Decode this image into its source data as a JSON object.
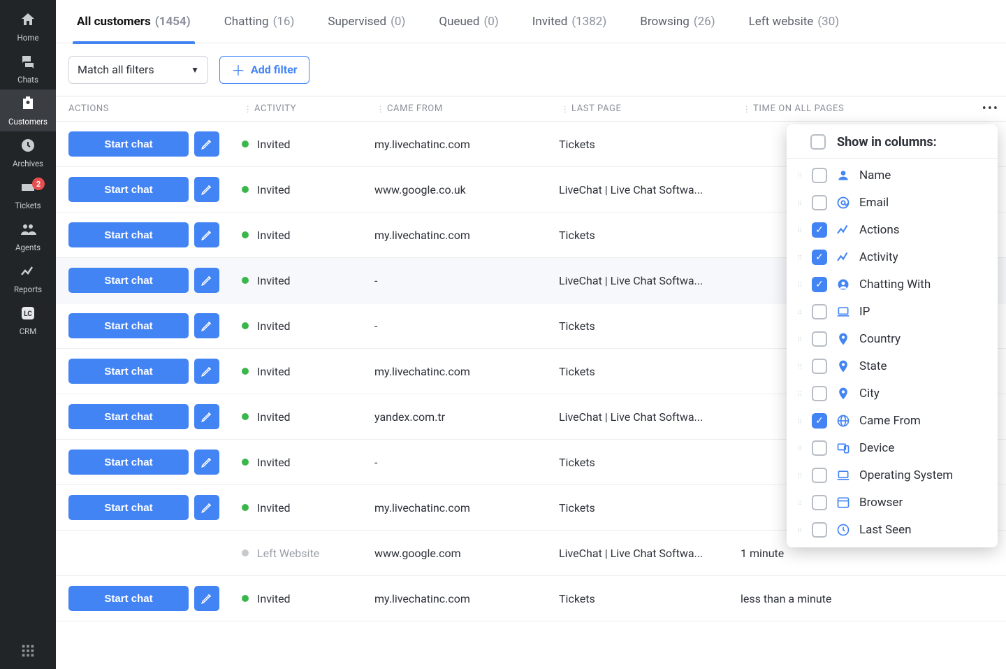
{
  "sidebar": {
    "items": [
      {
        "label": "Home"
      },
      {
        "label": "Chats"
      },
      {
        "label": "Customers"
      },
      {
        "label": "Archives"
      },
      {
        "label": "Tickets",
        "badge": "2"
      },
      {
        "label": "Agents"
      },
      {
        "label": "Reports"
      },
      {
        "label": "CRM"
      }
    ]
  },
  "tabs": [
    {
      "label": "All customers",
      "count": "(1454)"
    },
    {
      "label": "Chatting",
      "count": "(16)"
    },
    {
      "label": "Supervised",
      "count": "(0)"
    },
    {
      "label": "Queued",
      "count": "(0)"
    },
    {
      "label": "Invited",
      "count": "(1382)"
    },
    {
      "label": "Browsing",
      "count": "(26)"
    },
    {
      "label": "Left website",
      "count": "(30)"
    }
  ],
  "filters": {
    "mode": "Match all filters",
    "add_label": "Add filter"
  },
  "columns": {
    "actions": "ACTIONS",
    "activity": "ACTIVITY",
    "came": "CAME FROM",
    "last": "LAST PAGE",
    "time": "TIME ON ALL PAGES"
  },
  "buttons": {
    "start_chat": "Start chat"
  },
  "rows": [
    {
      "status": "green",
      "activity": "Invited",
      "came": "my.livechatinc.com",
      "last": "Tickets",
      "time": ""
    },
    {
      "status": "green",
      "activity": "Invited",
      "came": "www.google.co.uk",
      "last": "LiveChat | Live Chat Softwa...",
      "time": ""
    },
    {
      "status": "green",
      "activity": "Invited",
      "came": "my.livechatinc.com",
      "last": "Tickets",
      "time": ""
    },
    {
      "status": "green",
      "activity": "Invited",
      "came": "-",
      "last": "LiveChat | Live Chat Softwa...",
      "time": "",
      "hovered": true
    },
    {
      "status": "green",
      "activity": "Invited",
      "came": "-",
      "last": "Tickets",
      "time": ""
    },
    {
      "status": "green",
      "activity": "Invited",
      "came": "my.livechatinc.com",
      "last": "Tickets",
      "time": ""
    },
    {
      "status": "green",
      "activity": "Invited",
      "came": "yandex.com.tr",
      "last": "LiveChat | Live Chat Softwa...",
      "time": ""
    },
    {
      "status": "green",
      "activity": "Invited",
      "came": "-",
      "last": "Tickets",
      "time": ""
    },
    {
      "status": "green",
      "activity": "Invited",
      "came": "my.livechatinc.com",
      "last": "Tickets",
      "time": ""
    },
    {
      "status": "gray",
      "activity": "Left Website",
      "came": "www.google.com",
      "last": "LiveChat | Live Chat Softwa...",
      "time": "1 minute",
      "no_action": true
    },
    {
      "status": "green",
      "activity": "Invited",
      "came": "my.livechatinc.com",
      "last": "Tickets",
      "time": "less than a minute"
    }
  ],
  "popover": {
    "title": "Show in columns:",
    "options": [
      {
        "label": "Name",
        "checked": false,
        "icon": "person"
      },
      {
        "label": "Email",
        "checked": false,
        "icon": "at"
      },
      {
        "label": "Actions",
        "checked": true,
        "icon": "spark"
      },
      {
        "label": "Activity",
        "checked": true,
        "icon": "spark"
      },
      {
        "label": "Chatting With",
        "checked": true,
        "icon": "agent"
      },
      {
        "label": "IP",
        "checked": false,
        "icon": "laptop"
      },
      {
        "label": "Country",
        "checked": false,
        "icon": "pin"
      },
      {
        "label": "State",
        "checked": false,
        "icon": "pin"
      },
      {
        "label": "City",
        "checked": false,
        "icon": "pin"
      },
      {
        "label": "Came From",
        "checked": true,
        "icon": "globe"
      },
      {
        "label": "Device",
        "checked": false,
        "icon": "device"
      },
      {
        "label": "Operating System",
        "checked": false,
        "icon": "laptop"
      },
      {
        "label": "Browser",
        "checked": false,
        "icon": "browser"
      },
      {
        "label": "Last Seen",
        "checked": false,
        "icon": "clock"
      }
    ]
  }
}
